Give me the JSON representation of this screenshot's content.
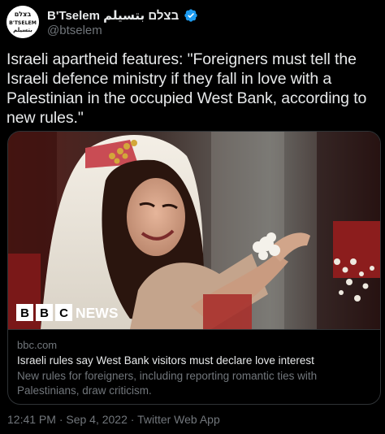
{
  "account": {
    "avatar_text_top": "בצלם",
    "avatar_text_mid": "B'TSELEM",
    "avatar_text_bottom": "بتسيلم",
    "display_name": "B'Tselem בצלם بتسيلم",
    "handle": "@btselem"
  },
  "tweet": {
    "text": "Israeli apartheid features: \"Foreigners must tell the Israeli defence ministry if they fall in love with a Palestinian in the occupied West Bank, according to new rules.\""
  },
  "card": {
    "image_badge": "BBC NEWS",
    "badge_letters": [
      "B",
      "B",
      "C"
    ],
    "badge_word": "NEWS",
    "domain": "bbc.com",
    "title": "Israeli rules say West Bank visitors must declare love interest",
    "description": "New rules for foreigners, including reporting romantic ties with Palestinians, draw criticism."
  },
  "meta": {
    "timestamp": "12:41 PM · Sep 4, 2022 · Twitter Web App"
  },
  "colors": {
    "background": "#000000",
    "text": "#e7e9ea",
    "secondary": "#71767b",
    "border": "#2f3336",
    "verified": "#1d9bf0"
  }
}
